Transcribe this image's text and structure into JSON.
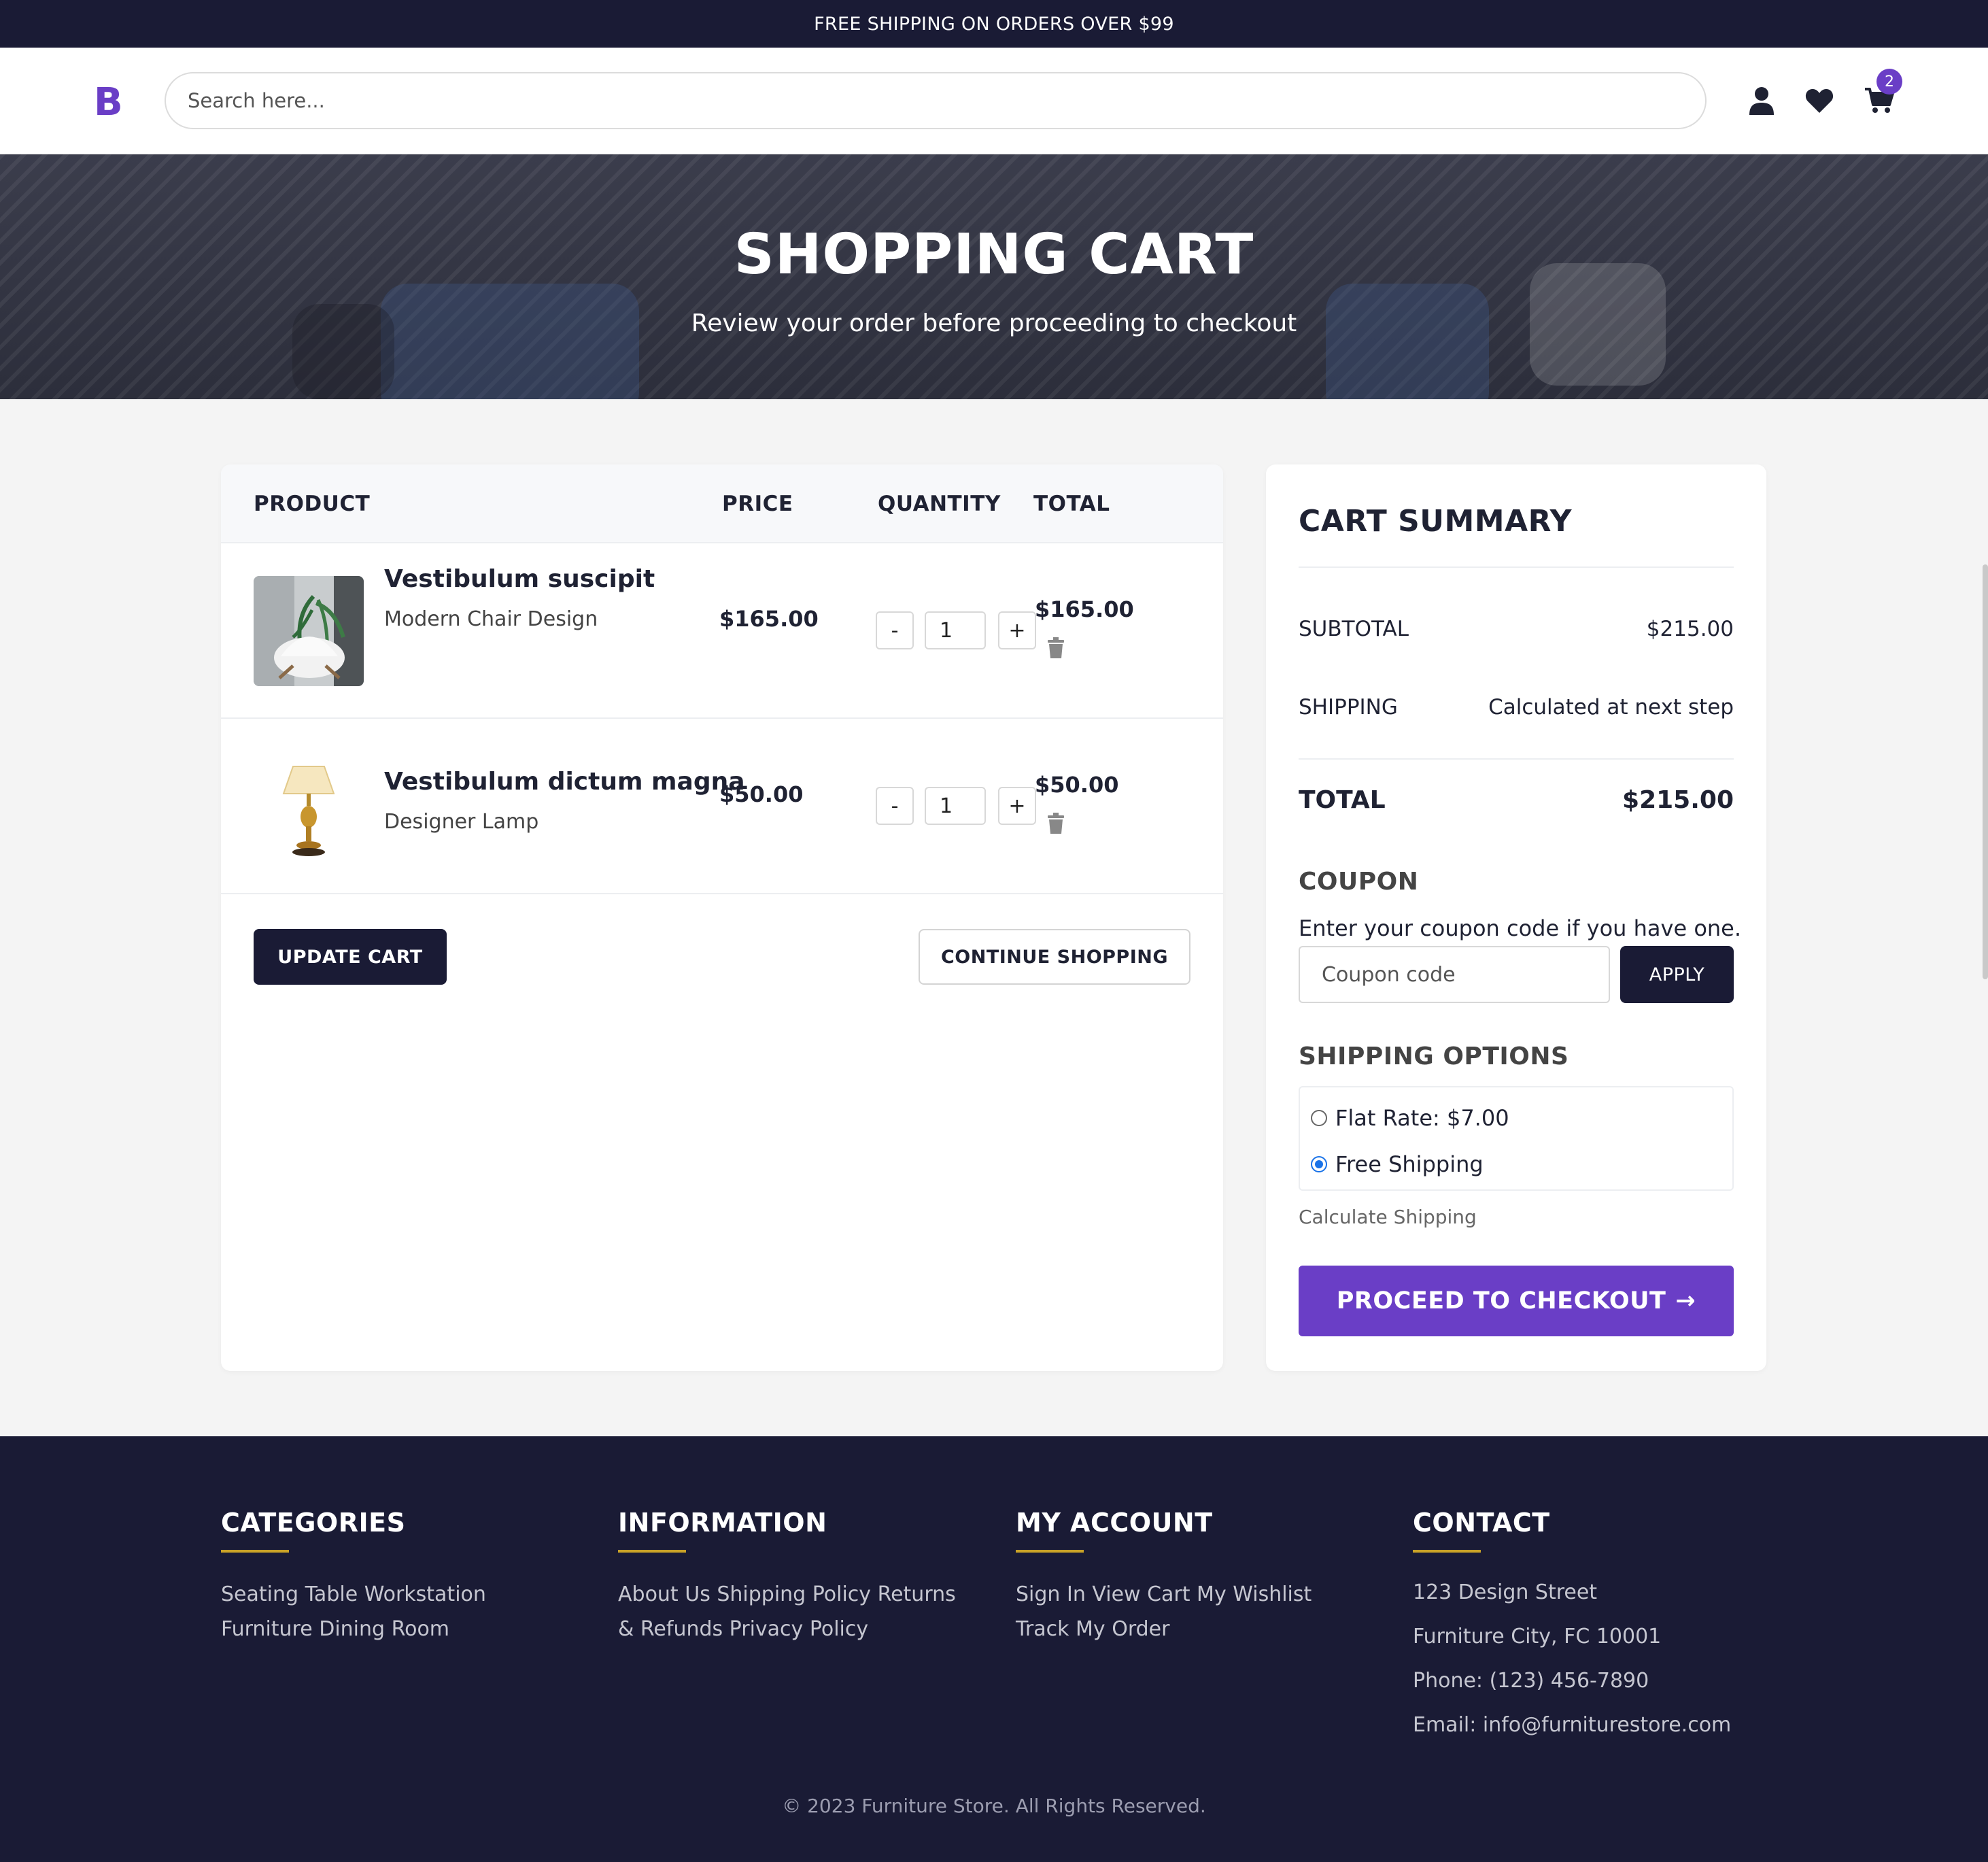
{
  "topbar": {
    "text": "FREE SHIPPING ON ORDERS OVER $99"
  },
  "header": {
    "logo": "B",
    "search_placeholder": "Search here...",
    "cart_count": "2",
    "icons": [
      "user-icon",
      "heart-icon",
      "cart-icon"
    ]
  },
  "hero": {
    "title": "SHOPPING CART",
    "subtitle": "Review your order before proceeding to checkout"
  },
  "cart": {
    "columns": {
      "product": "PRODUCT",
      "price": "PRICE",
      "quantity": "QUANTITY",
      "total": "TOTAL"
    },
    "items": [
      {
        "name": "Vestibulum suscipit",
        "sub": "Modern Chair Design",
        "price": "$165.00",
        "qty": "1",
        "total": "$165.00"
      },
      {
        "name": "Vestibulum dictum magna",
        "sub": "Designer Lamp",
        "price": "$50.00",
        "qty": "1",
        "total": "$50.00"
      }
    ],
    "minus": "-",
    "plus": "+",
    "update_label": "UPDATE CART",
    "continue_label": "CONTINUE SHOPPING"
  },
  "summary": {
    "title": "CART SUMMARY",
    "subtotal_label": "SUBTOTAL",
    "subtotal_value": "$215.00",
    "shipping_label": "SHIPPING",
    "shipping_value": "Calculated at next step",
    "total_label": "TOTAL",
    "total_value": "$215.00",
    "coupon_heading": "COUPON",
    "coupon_text": "Enter your coupon code if you have one.",
    "coupon_placeholder": "Coupon code",
    "apply_label": "APPLY",
    "shipping_options_heading": "SHIPPING OPTIONS",
    "options": [
      {
        "label": "Flat Rate: $7.00",
        "selected": false
      },
      {
        "label": "Free Shipping",
        "selected": true
      }
    ],
    "calculate_label": "Calculate Shipping",
    "checkout_label": "PROCEED TO CHECKOUT",
    "checkout_arrow": "→"
  },
  "footer": {
    "categories": {
      "heading": "CATEGORIES",
      "links": "Seating Table Workstation Furniture Dining Room"
    },
    "information": {
      "heading": "INFORMATION",
      "links": "About Us Shipping Policy Returns & Refunds Privacy Policy"
    },
    "account": {
      "heading": "MY ACCOUNT",
      "links": "Sign In View Cart My Wishlist Track My Order"
    },
    "contact": {
      "heading": "CONTACT",
      "lines": [
        "123 Design Street",
        "Furniture City, FC 10001",
        "Phone: (123) 456-7890",
        "Email: info@furniturestore.com"
      ]
    },
    "copyright": "© 2023 Furniture Store. All Rights Reserved."
  },
  "colors": {
    "accent": "#6a3ec6",
    "dark": "#1a1b35",
    "gold": "#c9a227"
  }
}
